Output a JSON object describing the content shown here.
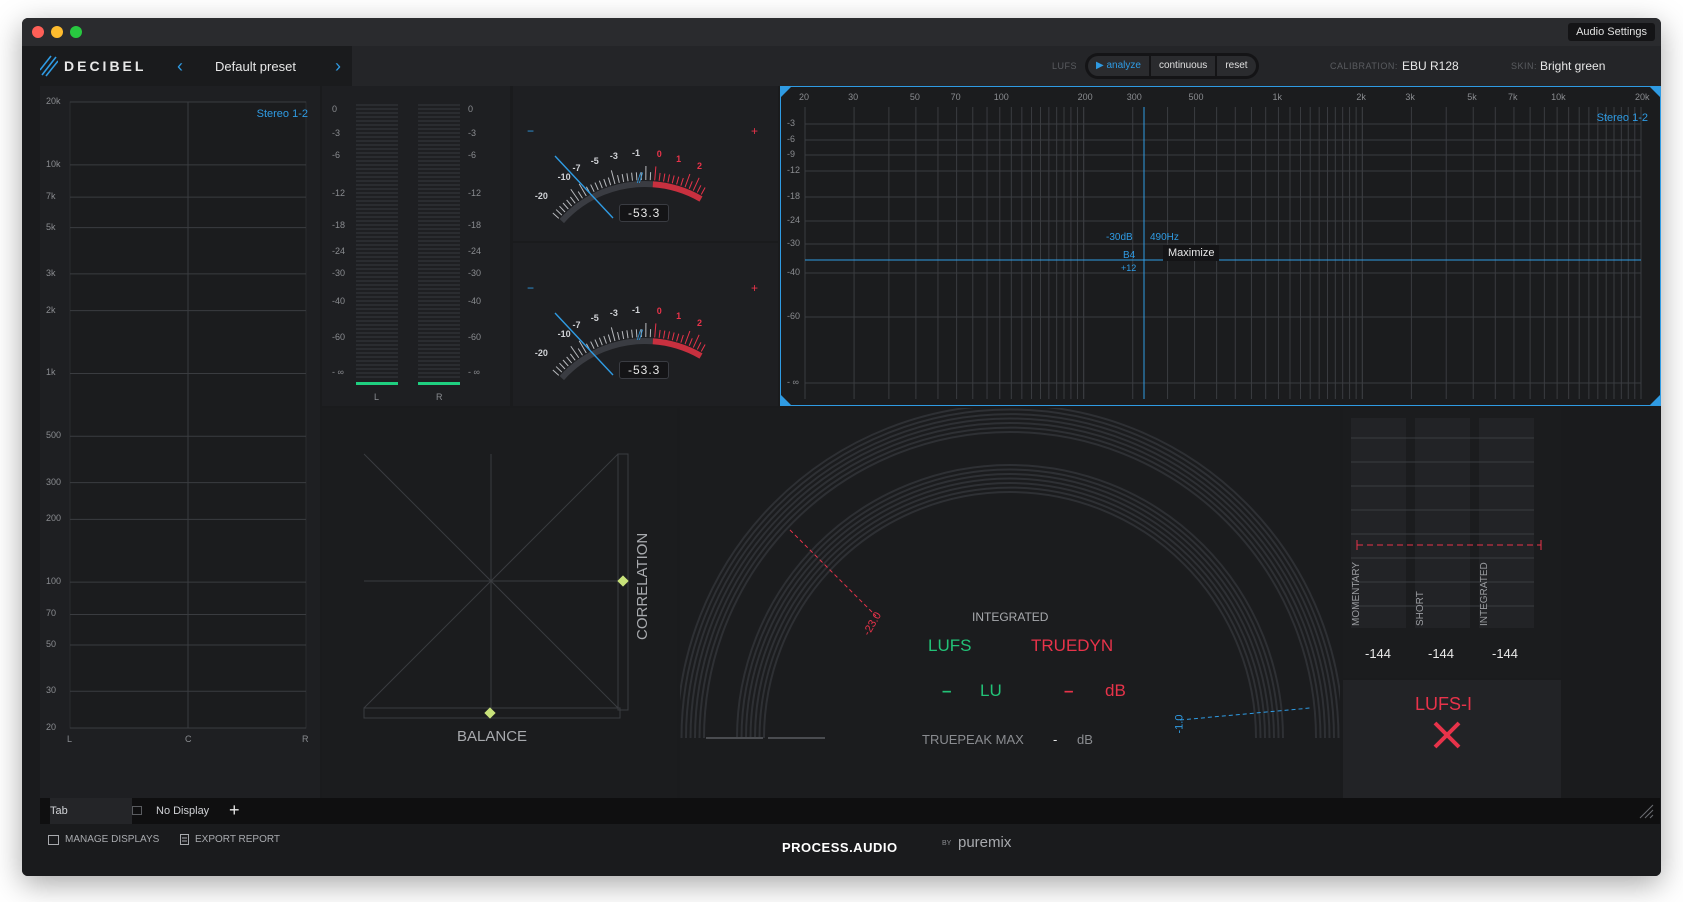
{
  "window": {
    "audio_settings": "Audio Settings"
  },
  "header": {
    "logo": "DECIBEL",
    "preset": "Default preset",
    "lufs_label": "LUFS",
    "buttons": [
      "▶ analyze",
      "continuous",
      "reset"
    ],
    "calibration_label": "CALIBRATION:",
    "calibration_value": "EBU R128",
    "skin_label": "SKIN:",
    "skin_value": "Bright green"
  },
  "spectrogram": {
    "channel": "Stereo 1-2",
    "freq_labels": [
      "20k",
      "10k",
      "7k",
      "5k",
      "3k",
      "2k",
      "1k",
      "500",
      "300",
      "200",
      "100",
      "70",
      "50",
      "30",
      "20"
    ],
    "x_labels": [
      "L",
      "C",
      "R"
    ]
  },
  "level_meter": {
    "scale": [
      "0",
      "-3",
      "-6",
      "-12",
      "-18",
      "-24",
      "-30",
      "-40",
      "-60",
      "- ∞"
    ],
    "channels": [
      "L",
      "R"
    ]
  },
  "vu_meters": [
    {
      "scale": [
        "-20",
        "-10",
        "-7",
        "-5",
        "-3",
        "-1",
        "0",
        "1",
        "2"
      ],
      "minus": "−",
      "plus": "+",
      "readout": "-53.3"
    },
    {
      "scale": [
        "-20",
        "-10",
        "-7",
        "-5",
        "-3",
        "-1",
        "0",
        "1",
        "2"
      ],
      "minus": "−",
      "plus": "+",
      "readout": "-53.3"
    }
  ],
  "spectrum": {
    "channel": "Stereo 1-2",
    "freq_labels": [
      "20",
      "30",
      "50",
      "70",
      "100",
      "200",
      "300",
      "500",
      "1k",
      "2k",
      "3k",
      "5k",
      "7k",
      "10k",
      "20k"
    ],
    "db_labels": [
      "-3",
      "-6",
      "-9",
      "-12",
      "-18",
      "-24",
      "-30",
      "-40",
      "-60",
      "- ∞"
    ],
    "cursor_db": "-30dB",
    "cursor_hz": "490Hz",
    "cursor_note": "B4",
    "cursor_cents": "+12",
    "tooltip": "Maximize"
  },
  "goniometer": {
    "balance": "BALANCE",
    "correlation": "CORRELATION"
  },
  "loudness_dial": {
    "target": "-23.0",
    "peak_mark": "-1.0",
    "integrated": "INTEGRATED",
    "lufs": "LUFS",
    "truedyn": "TRUEDYN",
    "lufs_value": "–",
    "lufs_unit": "LU",
    "truedyn_value": "–",
    "truedyn_unit": "dB",
    "truepeak_label": "TRUEPEAK MAX",
    "truepeak_value": "-",
    "truepeak_unit": "dB"
  },
  "loudness_bars": {
    "labels": [
      "MOMENTARY",
      "SHORT",
      "INTEGRATED"
    ],
    "values": [
      "-144",
      "-144",
      "-144"
    ]
  },
  "lufs_i": {
    "title": "LUFS-I"
  },
  "tabbar": {
    "tab": "Tab",
    "display": "No Display",
    "add": "+"
  },
  "footer": {
    "manage": "MANAGE DISPLAYS",
    "export": "EXPORT REPORT",
    "brand": "PROCESS.AUDIO",
    "by": "BY",
    "partner": "puremix"
  },
  "colors": {
    "accent": "#2f9be3",
    "green": "#22c277",
    "red": "#e8334a",
    "meter_green": "#1fcf80"
  }
}
